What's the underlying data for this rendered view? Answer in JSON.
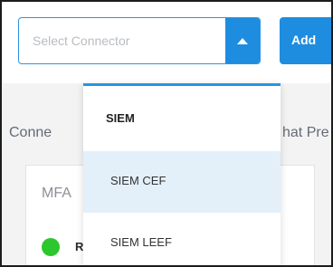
{
  "connector_select": {
    "placeholder": "Select Connector",
    "toggle_icon": "caret-up-icon"
  },
  "toolbar": {
    "add_label": "Add"
  },
  "background": {
    "connectors_heading": "Conne",
    "what_heading": "hat Pre"
  },
  "card": {
    "title": "MFA",
    "status_color": "#2cc72c",
    "row_label": "R"
  },
  "dropdown": {
    "group_label": "SIEM",
    "items": [
      {
        "label": "SIEM CEF",
        "selected": true
      },
      {
        "label": "SIEM LEEF",
        "selected": false
      }
    ]
  },
  "colors": {
    "accent": "#1e8de0",
    "selected_bg": "#e3f0fa"
  }
}
